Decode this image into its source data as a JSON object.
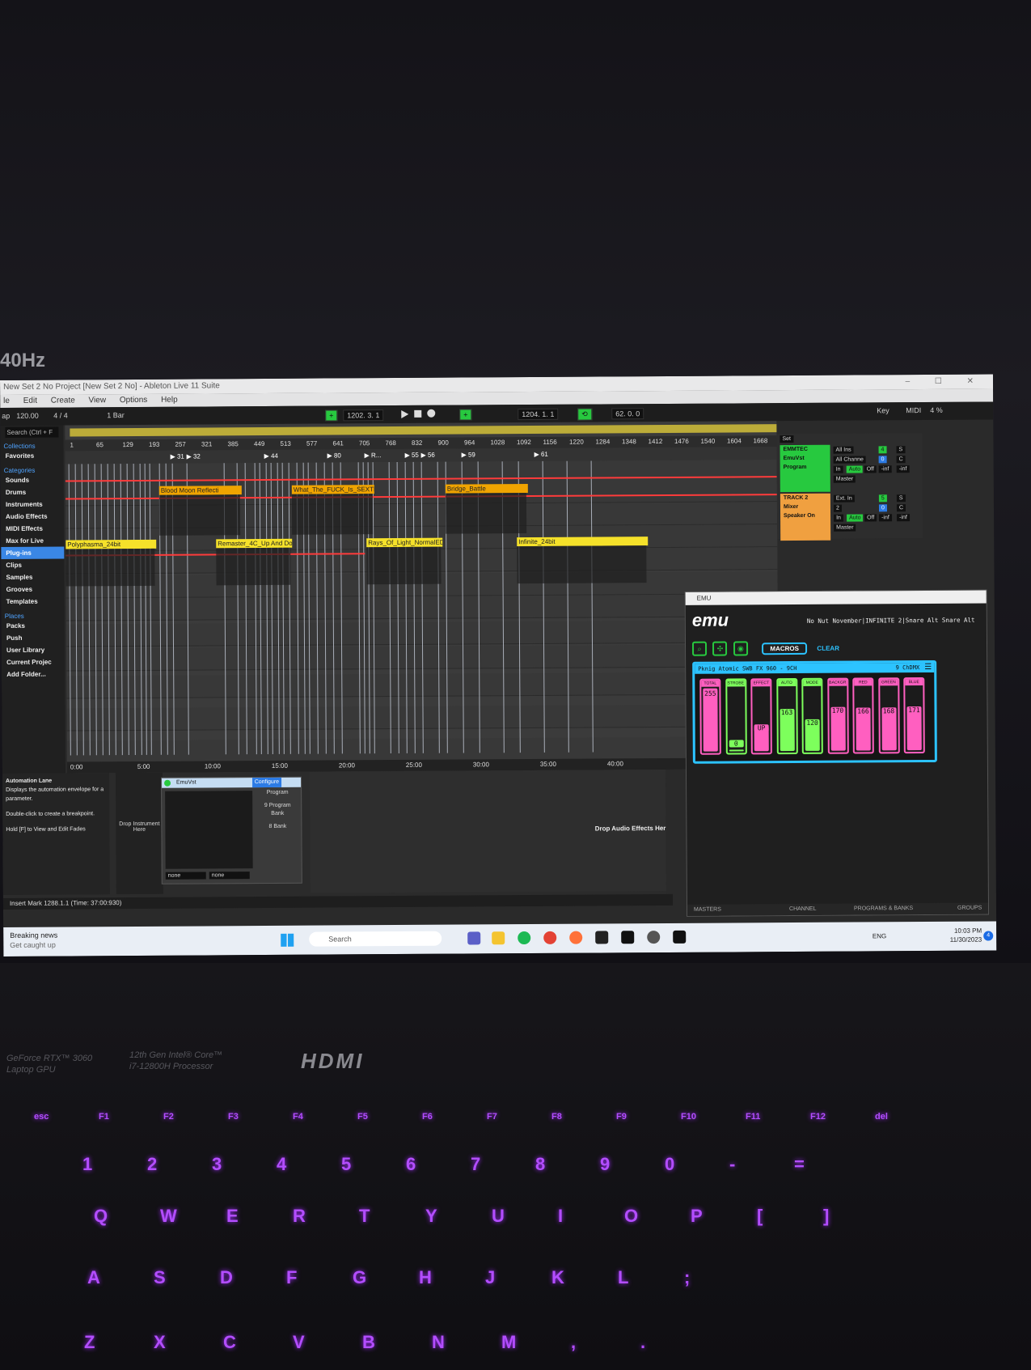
{
  "bezel": {
    "refresh_label": "40Hz"
  },
  "window": {
    "title": "New Set 2 No Project  [New Set 2 No] - Ableton Live 11 Suite",
    "controls": "–  ☐  ✕"
  },
  "menu": [
    "le",
    "Edit",
    "Create",
    "View",
    "Options",
    "Help"
  ],
  "transport": {
    "tap": "ap",
    "tempo": "120.00",
    "meter": "4 / 4",
    "quantize": "1 Bar",
    "position": "1202.  3.  1",
    "loop_length": "1204.  1.  1",
    "punch": "62.  0.  0",
    "key_label": "Key",
    "midi_label": "MIDI",
    "cpu": "4 %",
    "hw": "H   W"
  },
  "browser": {
    "search": "Search (Ctrl + F",
    "collections_header": "Collections",
    "favorites": "Favorites",
    "categories_header": "Categories",
    "categories": [
      "Sounds",
      "Drums",
      "Instruments",
      "Audio Effects",
      "MIDI Effects",
      "Max for Live",
      "Plug-ins",
      "Clips",
      "Samples",
      "Grooves",
      "Templates"
    ],
    "selected_index": 6,
    "places_header": "Places",
    "places": [
      "Packs",
      "Push",
      "User Library",
      "Current Projec",
      "Add Folder..."
    ]
  },
  "arrangement": {
    "ruler": [
      "1",
      "65",
      "129",
      "193",
      "257",
      "321",
      "385",
      "449",
      "513",
      "577",
      "641",
      "705",
      "768",
      "832",
      "900",
      "964",
      "1028",
      "1092",
      "1156",
      "1220",
      "1284",
      "1348",
      "1412",
      "1476",
      "1540",
      "1604",
      "1668"
    ],
    "signature_start": "4/4",
    "signature_mid": "6/4",
    "signature_mid2": "4/4",
    "locators": [
      "31",
      "32",
      "44",
      "80",
      "R...",
      "55",
      "56",
      "59",
      "61"
    ],
    "time_ticks": [
      "0:00",
      "5:00",
      "10:00",
      "15:00",
      "20:00",
      "25:00",
      "30:00",
      "35:00",
      "40:00"
    ],
    "clips_top": [
      "Blood Moon Reflecti",
      "What_The_FUCK_Is_SEXTR",
      "Bridge_Battle"
    ],
    "clips_bottom": [
      "Polyphasma_24bit",
      "Remaster_4C_Up And Down",
      "Rays_Of_Light_NormalEDM",
      "Infinite_24bit"
    ]
  },
  "mixer": {
    "set_label": "Set",
    "track1": {
      "name": "EMMTEC",
      "device": "EmuVst",
      "chain": "Program",
      "input": "All Ins",
      "channel": "All Channe",
      "monitor_in": "In",
      "monitor_auto": "Auto",
      "monitor_off": "Off",
      "out": "Master",
      "vol": "-inf",
      "pan": "-inf",
      "num": "4",
      "s": "S",
      "c": "C",
      "zero": "0"
    },
    "track2": {
      "name": "TRACK 2",
      "device": "Mixer",
      "chain": "Speaker On",
      "input": "Ext. In",
      "channel": "2",
      "monitor_in": "In",
      "monitor_auto": "Auto",
      "monitor_off": "Off",
      "out": "Master",
      "vol": "-inf",
      "pan": "-inf",
      "num": "5",
      "s": "S",
      "c": "C",
      "zero": "0"
    }
  },
  "detail": {
    "info_title": "Automation Lane",
    "info_lines": [
      "Displays the automation envelope for a",
      "parameter.",
      "Double-click to create a breakpoint.",
      "Hold [F] to View and Edit Fades"
    ],
    "drop_instrument": "Drop Instrument Here",
    "device_name": "EmuVst",
    "configure": "Configure",
    "params": [
      "Program",
      "9 Program",
      "Bank",
      "8 Bank"
    ],
    "selectors": [
      "none",
      "none"
    ],
    "drop_fx": "Drop Audio Effects Her",
    "status": "Insert Mark 1288.1.1 (Time: 37:00:930)"
  },
  "emu": {
    "window_title": "EMU",
    "logo": "emu",
    "song": "No Nut November|INFINITE 2|Snare Alt   Snare Alt",
    "macros": "MACROS",
    "clear": "CLEAR",
    "fixture": "Pknig Atomic SWB FX 960 - 9CH",
    "channel_count": "9 ChDMX",
    "faders": [
      {
        "label": "TOTAL",
        "value": "255",
        "level": 1.0,
        "color": "pink"
      },
      {
        "label": "STROBE",
        "value": "0",
        "level": 0.0,
        "color": "green"
      },
      {
        "label": "EFFECT",
        "value": "UP",
        "level": 0.4,
        "color": "pink"
      },
      {
        "label": "AUTO",
        "value": "163",
        "level": 0.64,
        "color": "green"
      },
      {
        "label": "MODE",
        "value": "120",
        "level": 0.47,
        "color": "green"
      },
      {
        "label": "BACKGR",
        "value": "170",
        "level": 0.67,
        "color": "pink"
      },
      {
        "label": "RED",
        "value": "166",
        "level": 0.65,
        "color": "pink"
      },
      {
        "label": "GREEN",
        "value": "168",
        "level": 0.66,
        "color": "pink"
      },
      {
        "label": "BLUE",
        "value": "171",
        "level": 0.67,
        "color": "pink"
      }
    ],
    "tabs": [
      "MASTERS",
      "CHANNEL",
      "PROGRAMS & BANKS",
      "GROUPS"
    ]
  },
  "taskbar": {
    "news_title": "Breaking news",
    "news_sub": "Get caught up",
    "search": "Search",
    "lang": "ENG",
    "time": "10:03 PM",
    "date": "11/30/2023",
    "badge": "4"
  },
  "laptop": {
    "gpu": "GeForce RTX™ 3060",
    "gpu_sub": "Laptop GPU",
    "cpu": "12th Gen Intel® Core™",
    "cpu_sub": "i7-12800H Processor",
    "hdmi": "HDMI",
    "fkeys": [
      "esc",
      "F1",
      "F2",
      "F3",
      "F4",
      "F5",
      "F6",
      "F7",
      "F8",
      "F9",
      "F10",
      "F11",
      "F12",
      "del"
    ],
    "numkeys": [
      "1",
      "2",
      "3",
      "4",
      "5",
      "6",
      "7",
      "8",
      "9",
      "0",
      "-",
      "="
    ],
    "row_q": [
      "Q",
      "W",
      "E",
      "R",
      "T",
      "Y",
      "U",
      "I",
      "O",
      "P",
      "[",
      "]"
    ],
    "row_a": [
      "A",
      "S",
      "D",
      "F",
      "G",
      "H",
      "J",
      "K",
      "L",
      ";"
    ],
    "row_z": [
      "Z",
      "X",
      "C",
      "V",
      "B",
      "N",
      "M",
      ",",
      "."
    ]
  },
  "colors": {
    "accent_green": "#27c93f",
    "clip_orange": "#f0a400",
    "clip_yellow": "#f5e12a",
    "emu_cyan": "#2cc3ff",
    "emu_pink": "#ff5fc0",
    "emu_green": "#7dff5c",
    "automation_red": "#ff3b3b",
    "keyboard_glow": "#b34dff"
  }
}
